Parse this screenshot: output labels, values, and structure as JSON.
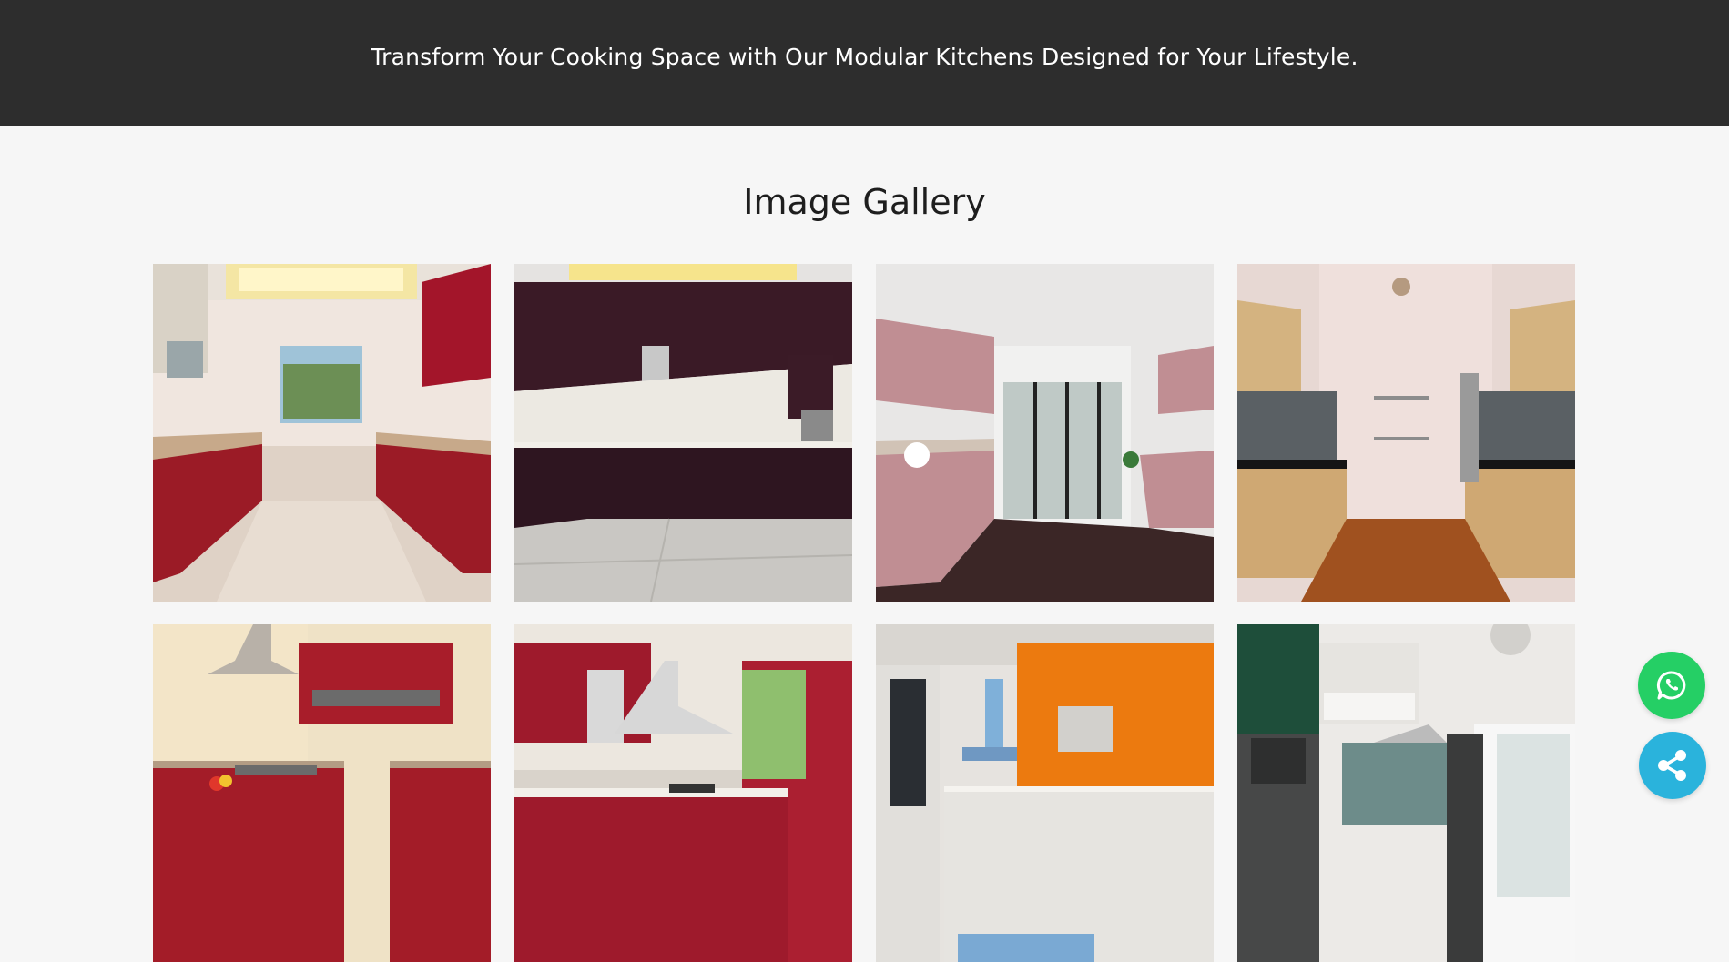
{
  "banner": {
    "text": "Transform Your Cooking Space with Our Modular Kitchens Designed for Your Lifestyle."
  },
  "gallery": {
    "title": "Image Gallery",
    "images": [
      {
        "name": "kitchen-image-red-parallel"
      },
      {
        "name": "kitchen-image-plum-l-shaped"
      },
      {
        "name": "kitchen-image-pink-parallel"
      },
      {
        "name": "kitchen-image-wood-parallel"
      },
      {
        "name": "kitchen-image-red-l-shaped"
      },
      {
        "name": "kitchen-image-red-island"
      },
      {
        "name": "kitchen-image-orange-straight"
      },
      {
        "name": "kitchen-image-green-grey"
      }
    ]
  },
  "floating_buttons": {
    "whatsapp_icon": "whatsapp-icon",
    "share_icon": "share-icon",
    "whatsapp_color": "#25cf65",
    "share_color": "#2ab3dc"
  },
  "colors": {
    "banner_bg": "#2d2d2d",
    "page_bg": "#f6f6f6"
  }
}
